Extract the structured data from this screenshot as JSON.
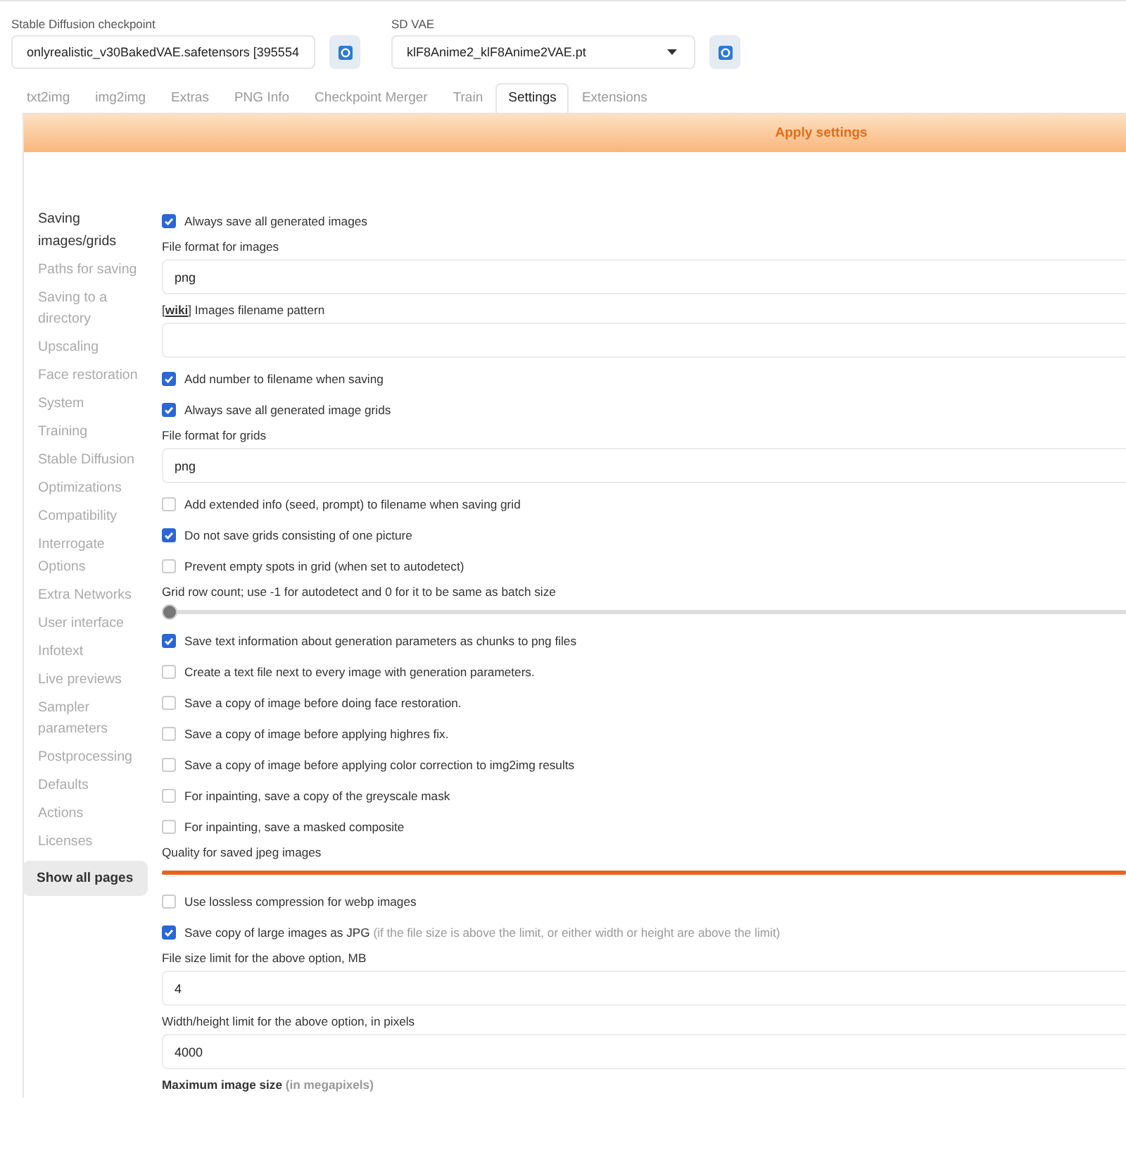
{
  "model_selectors": [
    {
      "label": "Stable Diffusion checkpoint",
      "value": "onlyrealistic_v30BakedVAE.safetensors [395554"
    },
    {
      "label": "SD VAE",
      "value": "klF8Anime2_klF8Anime2VAE.pt"
    }
  ],
  "tabs": [
    {
      "label": "txt2img",
      "selected": false
    },
    {
      "label": "img2img",
      "selected": false
    },
    {
      "label": "Extras",
      "selected": false
    },
    {
      "label": "PNG Info",
      "selected": false
    },
    {
      "label": "Checkpoint Merger",
      "selected": false
    },
    {
      "label": "Train",
      "selected": false
    },
    {
      "label": "Settings",
      "selected": true
    },
    {
      "label": "Extensions",
      "selected": false
    }
  ],
  "apply_button": "Apply settings",
  "sidebar": {
    "items": [
      {
        "label": "Saving images/grids",
        "selected": true
      },
      {
        "label": "Paths for saving",
        "selected": false
      },
      {
        "label": "Saving to a directory",
        "selected": false
      },
      {
        "label": "Upscaling",
        "selected": false
      },
      {
        "label": "Face restoration",
        "selected": false
      },
      {
        "label": "System",
        "selected": false
      },
      {
        "label": "Training",
        "selected": false
      },
      {
        "label": "Stable Diffusion",
        "selected": false
      },
      {
        "label": "Optimizations",
        "selected": false
      },
      {
        "label": "Compatibility",
        "selected": false
      },
      {
        "label": "Interrogate Options",
        "selected": false
      },
      {
        "label": "Extra Networks",
        "selected": false
      },
      {
        "label": "User interface",
        "selected": false
      },
      {
        "label": "Infotext",
        "selected": false
      },
      {
        "label": "Live previews",
        "selected": false
      },
      {
        "label": "Sampler parameters",
        "selected": false
      },
      {
        "label": "Postprocessing",
        "selected": false
      },
      {
        "label": "Defaults",
        "selected": false
      },
      {
        "label": "Actions",
        "selected": false
      },
      {
        "label": "Licenses",
        "selected": false
      }
    ],
    "show_all_button": "Show all pages"
  },
  "settings": [
    {
      "kind": "checkbox",
      "label": "Always save all generated images",
      "checked": true
    },
    {
      "kind": "text",
      "label": "File format for images",
      "value": "png"
    },
    {
      "kind": "text",
      "label_before": "[",
      "link": "wiki",
      "label": "] Images filename pattern"
    },
    {
      "kind": "checkbox",
      "label": "Add number to filename when saving",
      "checked": true
    },
    {
      "kind": "checkbox",
      "label": "Always save all generated image grids",
      "checked": true
    },
    {
      "kind": "text",
      "label": "File format for grids",
      "value": "png"
    },
    {
      "kind": "checkbox",
      "label": "Add extended info (seed, prompt) to filename when saving grid",
      "checked": false
    },
    {
      "kind": "checkbox",
      "label": "Do not save grids consisting of one picture",
      "checked": true
    },
    {
      "kind": "checkbox",
      "label": "Prevent empty spots in grid (when set to autodetect)",
      "checked": false
    },
    {
      "kind": "slider",
      "label": "Grid row count; use -1 for autodetect and 0 for it to be same as batch size",
      "level": 0
    },
    {
      "kind": "checkbox",
      "label": "Save text information about generation parameters as chunks to png files",
      "checked": true
    },
    {
      "kind": "checkbox",
      "label": "Create a text file next to every image with generation parameters.",
      "checked": false
    },
    {
      "kind": "checkbox",
      "label": "Save a copy of image before doing face restoration.",
      "checked": false
    },
    {
      "kind": "checkbox",
      "label": "Save a copy of image before applying highres fix.",
      "checked": false
    },
    {
      "kind": "checkbox",
      "label": "Save a copy of image before applying color correction to img2img results",
      "checked": false
    },
    {
      "kind": "checkbox",
      "label": "For inpainting, save a copy of the greyscale mask",
      "checked": false
    },
    {
      "kind": "checkbox",
      "label": "For inpainting, save a masked composite",
      "checked": false
    },
    {
      "kind": "slider",
      "label": "Quality for saved jpeg images",
      "level": 1
    },
    {
      "kind": "checkbox",
      "label": "Use lossless compression for webp images",
      "checked": false
    },
    {
      "kind": "checkbox",
      "label": "Save copy of large images as JPG",
      "hint": "(if the file size is above the limit, or either width or height are above the limit)",
      "checked": true
    },
    {
      "kind": "text",
      "label": "File size limit for the above option, MB",
      "value": "4"
    },
    {
      "kind": "text",
      "label": "Width/height limit for the above option, in pixels",
      "value": "4000"
    },
    {
      "kind": "label",
      "label": "Maximum image size",
      "hint": "(in megapixels)"
    }
  ]
}
